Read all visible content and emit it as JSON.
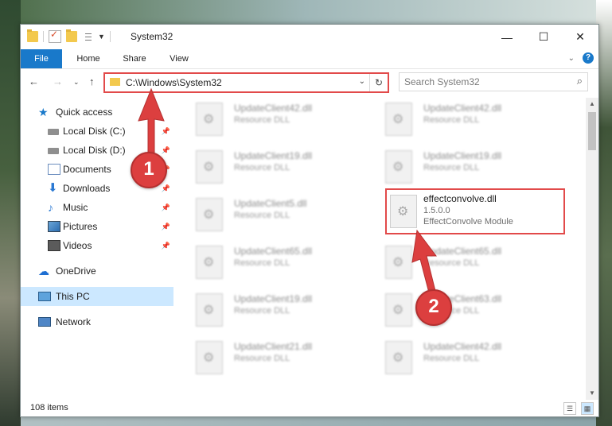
{
  "window": {
    "title": "System32",
    "controls": {
      "minimize": "—",
      "maximize": "☐",
      "close": "✕"
    }
  },
  "ribbon": {
    "tabs": [
      "File",
      "Home",
      "Share",
      "View"
    ]
  },
  "address": {
    "path": "C:\\Windows\\System32",
    "search_placeholder": "Search System32"
  },
  "sidebar": {
    "items": [
      {
        "label": "Quick access",
        "icon": "star-icon",
        "pinned": false
      },
      {
        "label": "Local Disk (C:)",
        "icon": "drive-icon",
        "pinned": true
      },
      {
        "label": "Local Disk (D:)",
        "icon": "drive-icon",
        "pinned": true
      },
      {
        "label": "Documents",
        "icon": "documents-icon",
        "pinned": true
      },
      {
        "label": "Downloads",
        "icon": "download-icon",
        "pinned": true
      },
      {
        "label": "Music",
        "icon": "music-icon",
        "pinned": true
      },
      {
        "label": "Pictures",
        "icon": "pictures-icon",
        "pinned": true
      },
      {
        "label": "Videos",
        "icon": "videos-icon",
        "pinned": true
      },
      {
        "label": "OneDrive",
        "icon": "cloud-icon",
        "pinned": false
      },
      {
        "label": "This PC",
        "icon": "computer-icon",
        "pinned": false,
        "selected": true
      },
      {
        "label": "Network",
        "icon": "network-icon",
        "pinned": false
      }
    ]
  },
  "files": {
    "col1": [
      {
        "name": "UpdateClient42.dll",
        "desc": "Resource DLL"
      },
      {
        "name": "UpdateClient19.dll",
        "desc": "Resource DLL"
      },
      {
        "name": "UpdateClient5.dll",
        "desc": "Resource DLL"
      },
      {
        "name": "UpdateClient65.dll",
        "desc": "Resource DLL"
      },
      {
        "name": "UpdateClient19.dll",
        "desc": "Resource DLL"
      },
      {
        "name": "UpdateClient21.dll",
        "desc": "Resource DLL"
      }
    ],
    "col2": [
      {
        "name": "UpdateClient42.dll",
        "desc": "Resource DLL"
      },
      {
        "name": "UpdateClient19.dll",
        "desc": "Resource DLL"
      },
      {
        "name": "effectconvolve.dll",
        "version": "1.5.0.0",
        "desc": "EffectConvolve Module",
        "highlighted": true
      },
      {
        "name": "UpdateClient65.dll",
        "desc": "Resource DLL"
      },
      {
        "name": "UpdateClient63.dll",
        "desc": "Resource DLL"
      },
      {
        "name": "UpdateClient42.dll",
        "desc": "Resource DLL"
      }
    ]
  },
  "status": {
    "count": "108 items"
  },
  "annotations": {
    "marker1": "1",
    "marker2": "2",
    "color": "#dc3f3f"
  }
}
